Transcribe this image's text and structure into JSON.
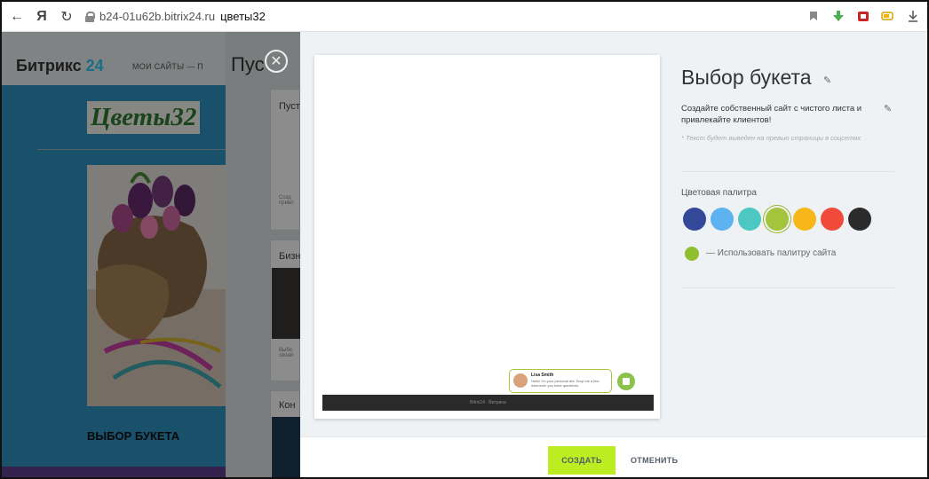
{
  "browser": {
    "back": "←",
    "yandex": "Я",
    "reload": "↻",
    "domain": "b24-01u62b.bitrix24.ru",
    "title": "цветы32"
  },
  "background": {
    "logo_main": "Битрикс ",
    "logo_num": "24",
    "nav": "МОИ САЙТЫ  —  П",
    "site_title": "Цветы32",
    "caption": "ВЫБОР БУКЕТА",
    "panel_title": "Пус",
    "cards": [
      {
        "title": "Пуст",
        "text": "Созд привл"
      },
      {
        "title": "Бизн",
        "text": "Выбе своей"
      },
      {
        "title": "Кон",
        "text": ""
      }
    ]
  },
  "preview": {
    "chat_name": "Lisa Smith",
    "chat_text": "Hello! I'm your personal aid. Drop me a line whenever you have questions.",
    "footer": "Bitrix24 · Витрина"
  },
  "settings": {
    "title": "Выбор букета",
    "description": "Создайте собственный сайт с чистого листа и привлекайте клиентов!",
    "note": "* Текст будет выведен на превью страницы в соцсетях",
    "palette_label": "Цветовая палитра",
    "palette": [
      "#34489a",
      "#5cb3f0",
      "#4cc7c1",
      "#a4c43c",
      "#f8b718",
      "#f04b3a",
      "#2b2b2b"
    ],
    "selected_index": 3,
    "use_site_palette": "— Использовать палитру сайта",
    "site_palette_color": "#8fbf2f"
  },
  "actions": {
    "create": "СОЗДАТЬ",
    "cancel": "ОТМЕНИТЬ"
  }
}
